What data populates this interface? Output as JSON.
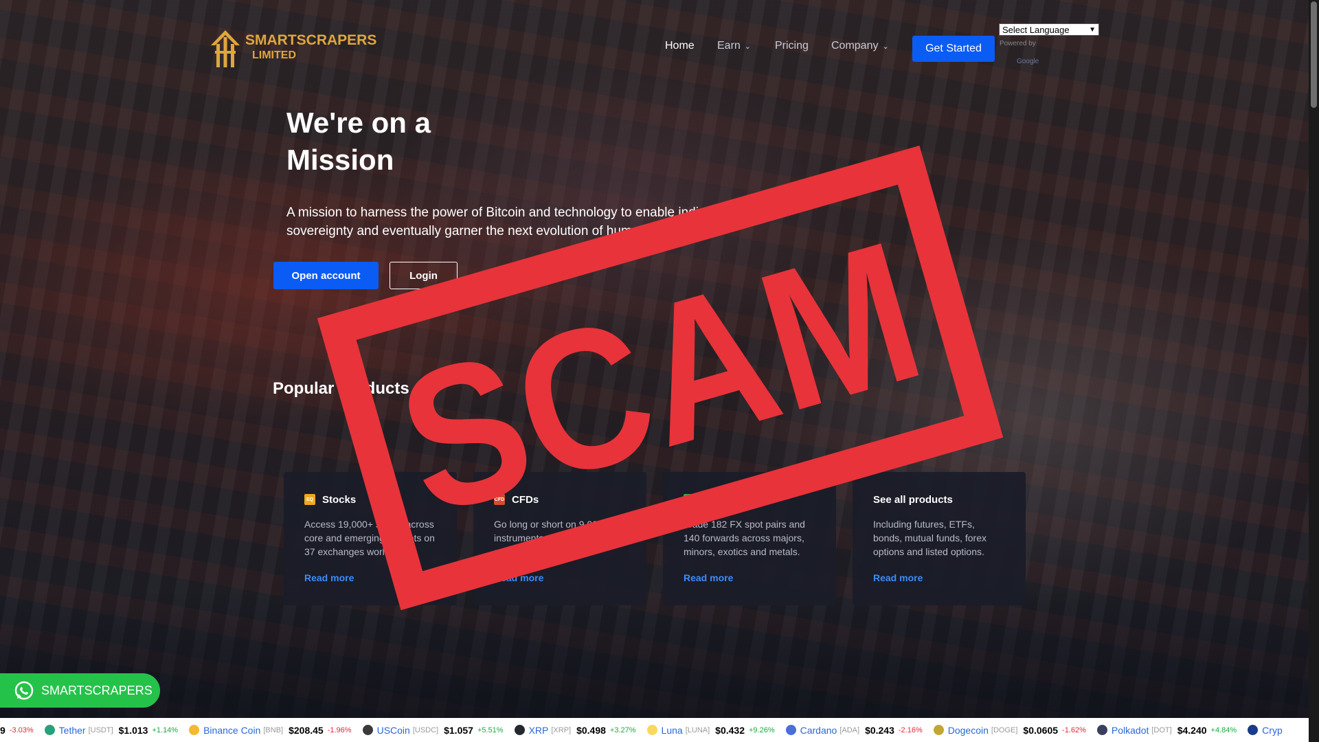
{
  "brand": {
    "line1": "SMARTSCRAPERS",
    "line2": "LIMITED"
  },
  "nav": {
    "home": "Home",
    "earn": "Earn",
    "pricing": "Pricing",
    "company": "Company",
    "get_started": "Get Started"
  },
  "translate": {
    "select_label": "Select Language",
    "powered": "Powered by",
    "google": "Google"
  },
  "hero": {
    "title": "We're on a Mission",
    "subtitle": "A mission to harness the power of Bitcoin and technology to enable individual sovereignty and eventually garner the next evolution of humanity.",
    "open_account": "Open account",
    "login": "Login"
  },
  "products": {
    "title": "Popular products",
    "cards": [
      {
        "icon": "EQ",
        "icon_color": "#f0a81c",
        "title": "Stocks",
        "desc": "Access 19,000+ stocks across core and emerging markets on 37 exchanges worldwide.",
        "link": "Read more"
      },
      {
        "icon": "CFD",
        "icon_color": "#d94a2a",
        "title": "CFDs",
        "desc": "Go long or short on 9,000+ instruments with tight spreads and low commissions.",
        "link": "Read more"
      },
      {
        "icon": "FX",
        "icon_color": "#2fa84f",
        "title": "Forex",
        "desc": "Trade 182 FX spot pairs and 140 forwards across majors, minors, exotics and metals.",
        "link": "Read more"
      },
      {
        "icon": "",
        "icon_color": "",
        "title": "See all products",
        "desc": "Including futures, ETFs, bonds, mutual funds, forex options and listed options.",
        "link": "Read more"
      }
    ]
  },
  "stamp": {
    "text": "SCAM",
    "color": "#e8333a"
  },
  "whatsapp": {
    "label": "SMARTSCRAPERS"
  },
  "ticker": [
    {
      "name": "",
      "symbol": "",
      "price": "9",
      "change": "-3.03%",
      "dir": "neg",
      "color": "#f7931a"
    },
    {
      "name": "Tether",
      "symbol": "[USDT]",
      "price": "$1.013",
      "change": "+1.14%",
      "dir": "pos",
      "color": "#26a17b"
    },
    {
      "name": "Binance Coin",
      "symbol": "[BNB]",
      "price": "$208.45",
      "change": "-1.96%",
      "dir": "neg",
      "color": "#f3ba2f"
    },
    {
      "name": "USCoin",
      "symbol": "[USDC]",
      "price": "$1.057",
      "change": "+5.51%",
      "dir": "pos",
      "color": "#3a3a3a"
    },
    {
      "name": "XRP",
      "symbol": "[XRP]",
      "price": "$0.498",
      "change": "+3.27%",
      "dir": "pos",
      "color": "#23292f"
    },
    {
      "name": "Luna",
      "symbol": "[LUNA]",
      "price": "$0.432",
      "change": "+9.26%",
      "dir": "pos",
      "color": "#f9d85e"
    },
    {
      "name": "Cardano",
      "symbol": "[ADA]",
      "price": "$0.243",
      "change": "-2.16%",
      "dir": "neg",
      "color": "#4a6fd8"
    },
    {
      "name": "Dogecoin",
      "symbol": "[DOGE]",
      "price": "$0.0605",
      "change": "-1.62%",
      "dir": "neg",
      "color": "#c2a633"
    },
    {
      "name": "Polkadot",
      "symbol": "[DOT]",
      "price": "$4.240",
      "change": "+4.84%",
      "dir": "pos",
      "color": "#3a3f5c"
    },
    {
      "name": "Cryp",
      "symbol": "",
      "price": "",
      "change": "",
      "dir": "pos",
      "color": "#1a3a8a"
    }
  ]
}
